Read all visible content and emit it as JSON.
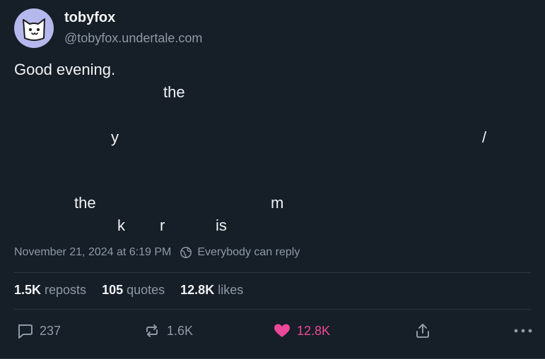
{
  "author": {
    "display_name": "tobyfox",
    "handle": "@tobyfox.undertale.com",
    "avatar_icon": "white-cat-face-icon",
    "avatar_bg": "#b5b8ec"
  },
  "post": {
    "text": "Good evening.",
    "fragments": [
      "the",
      "y",
      "/",
      "the",
      "m",
      "k",
      "r",
      "is"
    ]
  },
  "meta": {
    "timestamp": "November 21, 2024 at 6:19 PM",
    "reply_setting": "Everybody can reply",
    "reply_icon": "globe-icon"
  },
  "stats": {
    "reposts_count": "1.5K",
    "reposts_label": "reposts",
    "quotes_count": "105",
    "quotes_label": "quotes",
    "likes_count": "12.8K",
    "likes_label": "likes"
  },
  "actions": {
    "reply_count": "237",
    "repost_count": "1.6K",
    "like_count": "12.8K",
    "like_color": "#ec4899",
    "icons": [
      "reply-icon",
      "repost-icon",
      "heart-icon",
      "share-icon",
      "more-icon"
    ]
  },
  "colors": {
    "background": "#161e27",
    "text": "#f1f3f5",
    "muted": "#8d9aa7",
    "divider": "#2c3640"
  }
}
